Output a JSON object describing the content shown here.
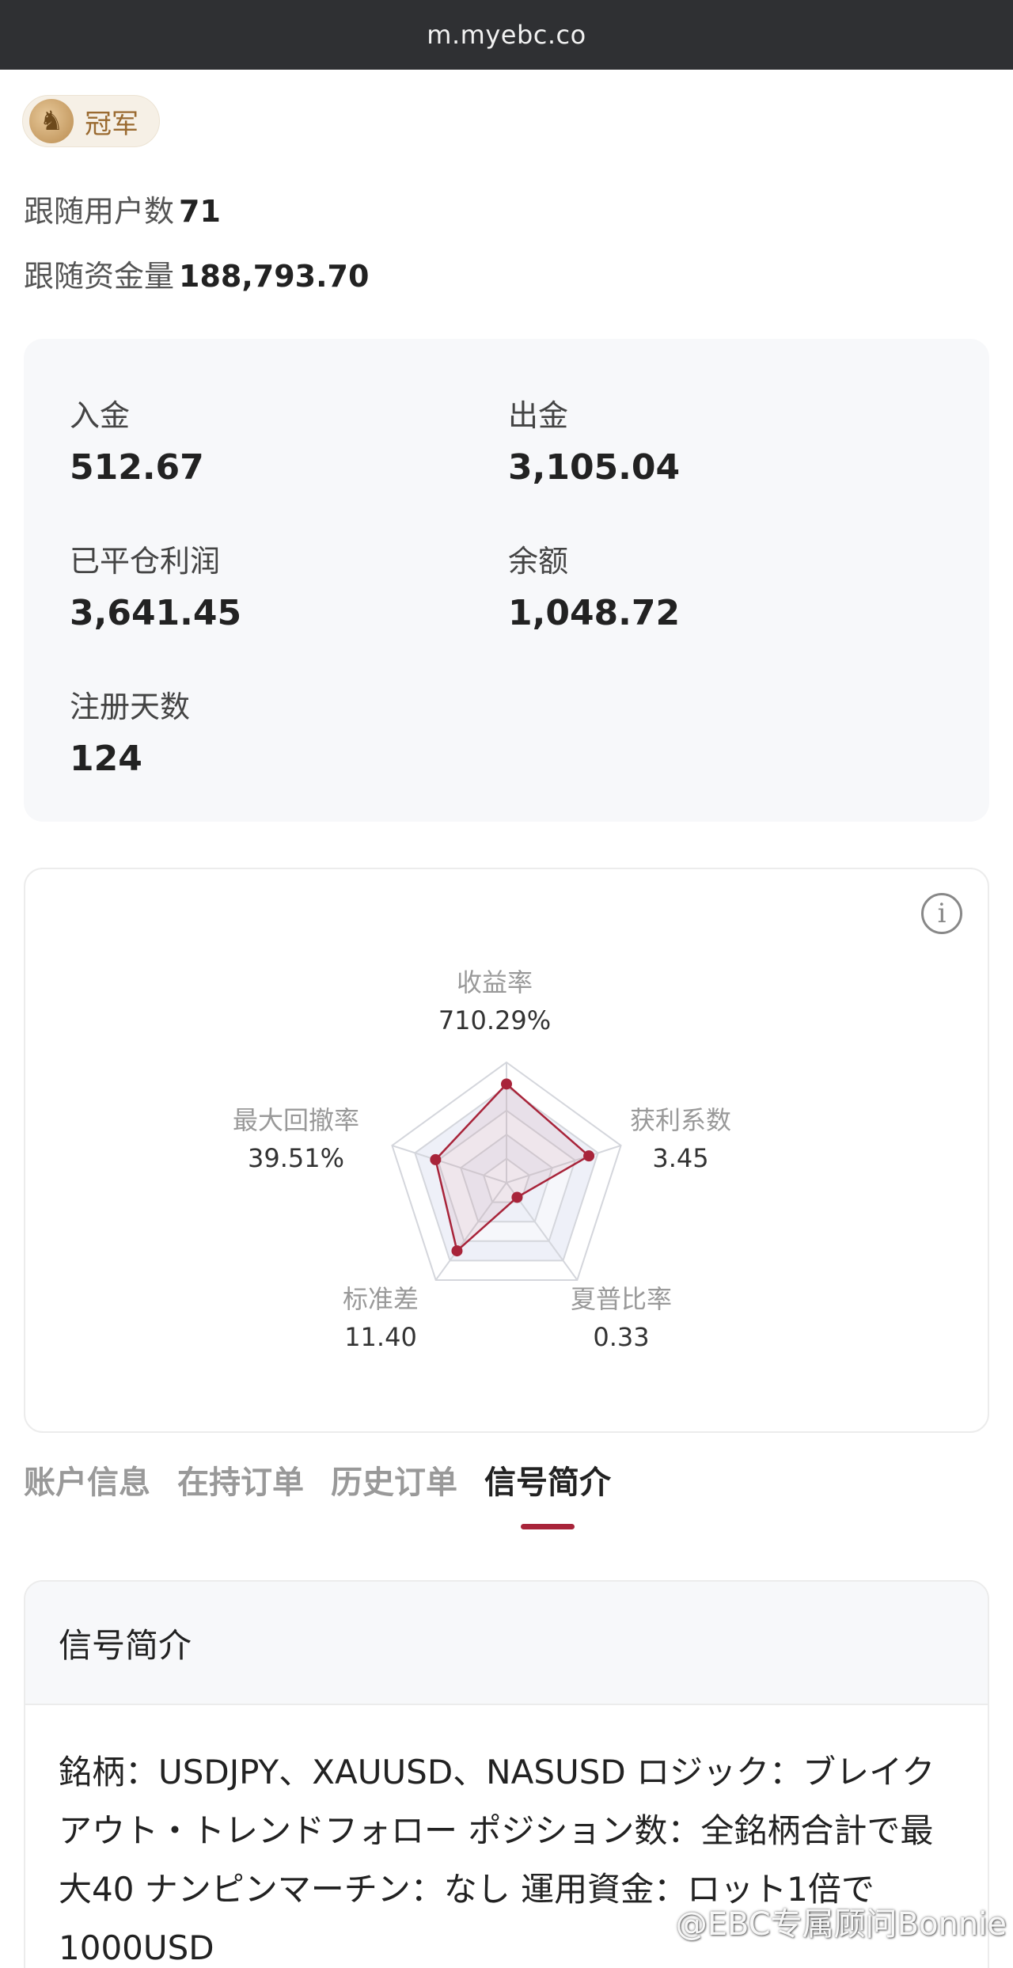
{
  "browser": {
    "url": "m.myebc.co"
  },
  "badge": {
    "label": "冠军",
    "icon": "horse-icon"
  },
  "followers": {
    "label": "跟随用户数",
    "value": "71"
  },
  "funds": {
    "label": "跟随资金量",
    "value": "188,793.70"
  },
  "stats": {
    "deposit": {
      "label": "入金",
      "value": "512.67"
    },
    "withdraw": {
      "label": "出金",
      "value": "3,105.04"
    },
    "closed_profit": {
      "label": "已平仓利润",
      "value": "3,641.45"
    },
    "balance": {
      "label": "余额",
      "value": "1,048.72"
    },
    "reg_days": {
      "label": "注册天数",
      "value": "124"
    }
  },
  "radar": {
    "accent": "#a8243a",
    "return_rate": {
      "label": "收益率",
      "value": "710.29%"
    },
    "profit_factor": {
      "label": "获利系数",
      "value": "3.45"
    },
    "sharpe": {
      "label": "夏普比率",
      "value": "0.33"
    },
    "std_dev": {
      "label": "标准差",
      "value": "11.40"
    },
    "max_drawdown": {
      "label": "最大回撤率",
      "value": "39.51%"
    }
  },
  "chart_data": {
    "type": "radar",
    "axes": [
      "收益率",
      "获利系数",
      "夏普比率",
      "标准差",
      "最大回撤率"
    ],
    "values": [
      "710.29%",
      "3.45",
      "0.33",
      "11.40",
      "39.51%"
    ],
    "normalized": [
      0.82,
      0.72,
      0.15,
      0.7,
      0.62
    ]
  },
  "tabs": [
    {
      "label": "账户信息"
    },
    {
      "label": "在持订单"
    },
    {
      "label": "历史订单"
    },
    {
      "label": "信号简介"
    }
  ],
  "signal": {
    "title": "信号简介",
    "body": "銘柄：USDJPY、XAUUSD、NASUSD ロジック：ブレイクアウト・トレンドフォロー ポジション数：全銘柄合計で最大40 ナンピンマーチン：なし 運用資金：ロット1倍で1000USD"
  },
  "watermark": "@EBC专属顾问Bonnie"
}
